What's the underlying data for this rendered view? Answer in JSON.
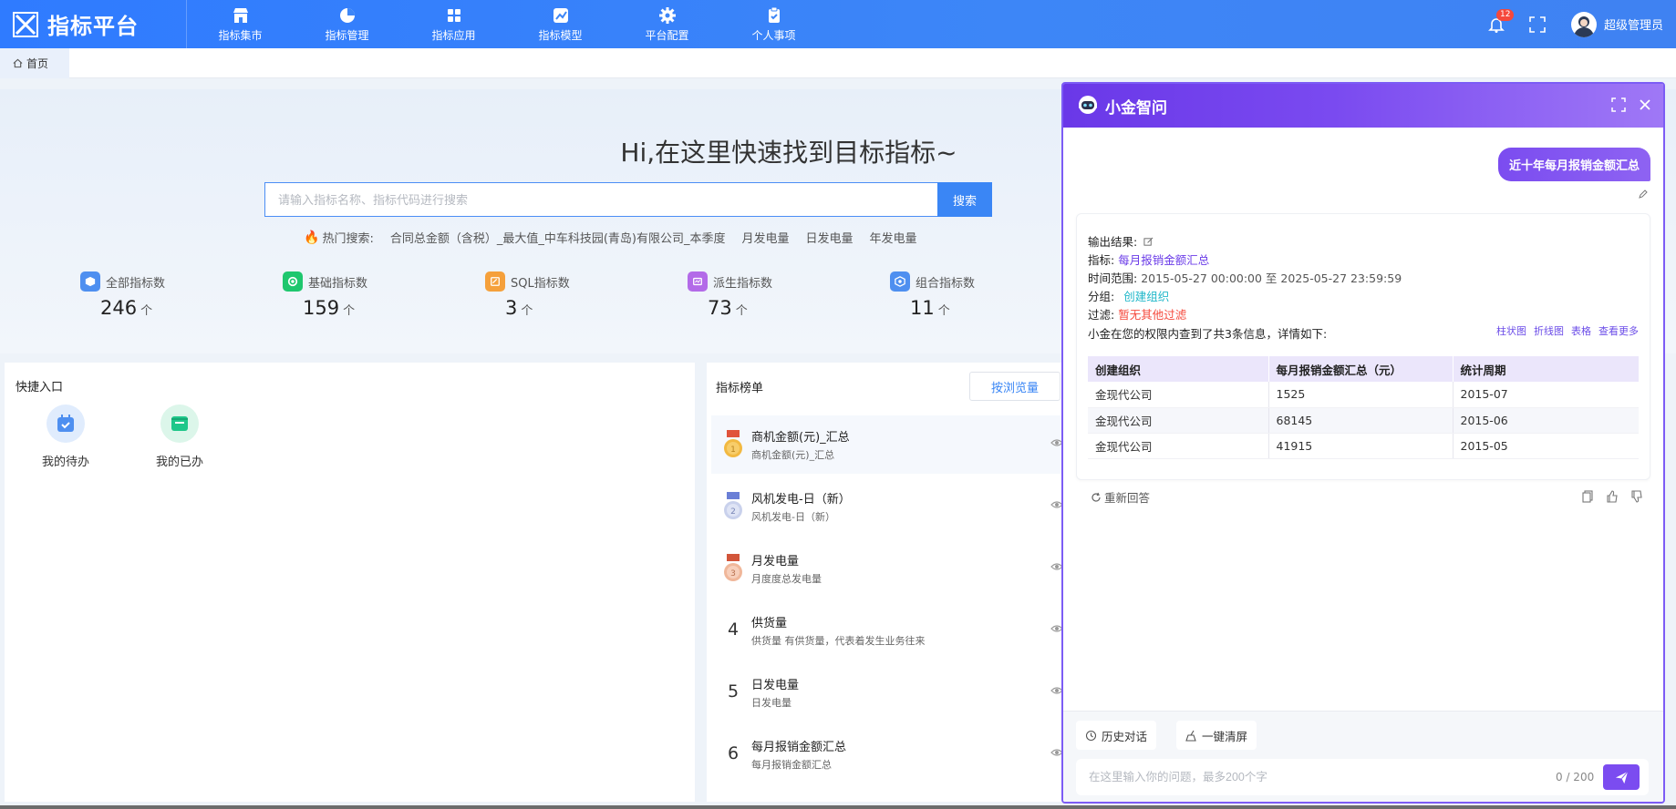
{
  "header": {
    "brand": "指标平台",
    "nav": [
      {
        "label": "指标集市",
        "icon": "store-icon"
      },
      {
        "label": "指标管理",
        "icon": "pie-chart-icon"
      },
      {
        "label": "指标应用",
        "icon": "apps-grid-icon"
      },
      {
        "label": "指标模型",
        "icon": "model-chart-icon"
      },
      {
        "label": "平台配置",
        "icon": "gear-icon"
      },
      {
        "label": "个人事项",
        "icon": "clipboard-icon"
      }
    ],
    "notification_count": "12",
    "username": "超级管理员"
  },
  "tabs": {
    "home": "首页"
  },
  "hero": {
    "title": "Hi,在这里快速找到目标指标~",
    "search_placeholder": "请输入指标名称、指标代码进行搜索",
    "search_button": "搜索",
    "hot_label": "热门搜索:",
    "hot_items": [
      "合同总金额（含税）_最大值_中车科技园(青岛)有限公司_本季度",
      "月发电量",
      "日发电量",
      "年发电量"
    ]
  },
  "stats": [
    {
      "label": "全部指标数",
      "value": "246",
      "unit": "个",
      "color": "#4e8ff0"
    },
    {
      "label": "基础指标数",
      "value": "159",
      "unit": "个",
      "color": "#1fc76e"
    },
    {
      "label": "SQL指标数",
      "value": "3",
      "unit": "个",
      "color": "#f5a03b"
    },
    {
      "label": "派生指标数",
      "value": "73",
      "unit": "个",
      "color": "#b36ae8"
    },
    {
      "label": "组合指标数",
      "value": "11",
      "unit": "个",
      "color": "#4e8ff0"
    }
  ],
  "quick": {
    "title": "快捷入口",
    "items": [
      {
        "label": "我的待办"
      },
      {
        "label": "我的已办"
      }
    ]
  },
  "ranking": {
    "title": "指标榜单",
    "sort_button": "按浏览量",
    "rows": [
      {
        "rank": "1",
        "title": "商机金额(元)_汇总",
        "subtitle": "商机金额(元)_汇总"
      },
      {
        "rank": "2",
        "title": "风机发电-日（新）",
        "subtitle": "风机发电-日（新）"
      },
      {
        "rank": "3",
        "title": "月发电量",
        "subtitle": "月度度总发电量"
      },
      {
        "rank": "4",
        "title": "供货量",
        "subtitle": "供货量 有供货量，代表着发生业务往来"
      },
      {
        "rank": "5",
        "title": "日发电量",
        "subtitle": "日发电量"
      },
      {
        "rank": "6",
        "title": "每月报销金额汇总",
        "subtitle": "每月报销金额汇总"
      }
    ]
  },
  "chat": {
    "title": "小金智问",
    "user_message": "近十年每月报销金额汇总",
    "answer": {
      "output_label": "输出结果:",
      "metric_label": "指标:",
      "metric_value": "每月报销金额汇总",
      "time_label": "时间范围:",
      "time_value": "2015-05-27 00:00:00 至 2025-05-27 23:59:59",
      "group_label": "分组:",
      "group_value": "创建组织",
      "filter_label": "过滤:",
      "filter_value": "暂无其他过滤",
      "summary": "小金在您的权限内查到了共3条信息，详情如下:",
      "links": [
        "柱状图",
        "折线图",
        "表格",
        "查看更多"
      ],
      "table": {
        "headers": [
          "创建组织",
          "每月报销金额汇总（元）",
          "统计周期"
        ],
        "rows": [
          [
            "金现代公司",
            "1525",
            "2015-07"
          ],
          [
            "金现代公司",
            "68145",
            "2015-06"
          ],
          [
            "金现代公司",
            "41915",
            "2015-05"
          ]
        ]
      }
    },
    "regenerate": "重新回答",
    "history_button": "历史对话",
    "clear_button": "一键清屏",
    "input_placeholder": "在这里输入你的问题，最多200个字",
    "counter": "0 / 200"
  }
}
